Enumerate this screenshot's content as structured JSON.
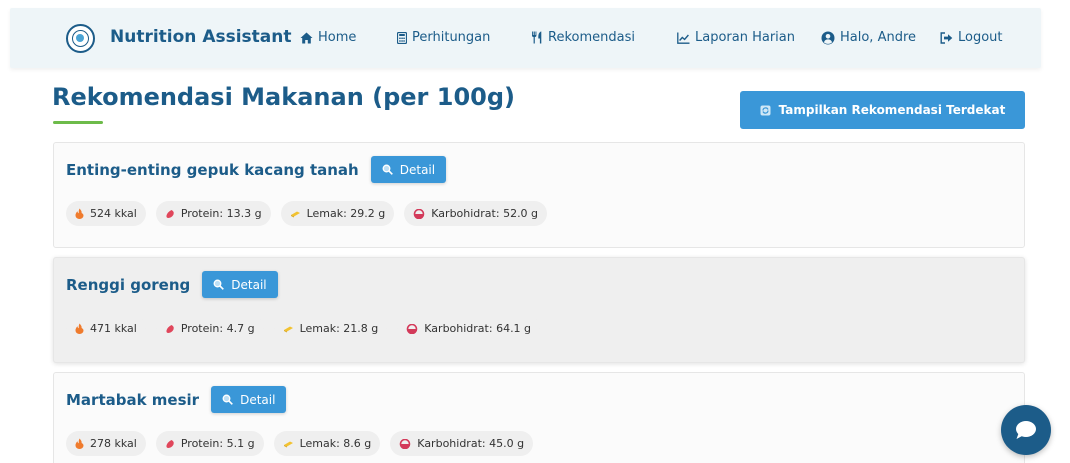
{
  "navbar": {
    "brand": "Nutrition Assistant",
    "items": [
      {
        "label": "Home",
        "icon": "home-icon"
      },
      {
        "label": "Perhitungan",
        "icon": "calculator-icon"
      },
      {
        "label": "Rekomendasi",
        "icon": "utensils-icon"
      },
      {
        "label": "Laporan Harian",
        "icon": "chart-line-icon"
      },
      {
        "label": "Halo, Andre",
        "icon": "user-circle-icon"
      },
      {
        "label": "Logout",
        "icon": "logout-icon"
      }
    ]
  },
  "main": {
    "title": "Rekomendasi Makanan (per 100g)",
    "nearest_button": "Tampilkan Rekomendasi Terdekat",
    "detail_label": "Detail",
    "foods": [
      {
        "name": "Enting-enting gepuk kacang tanah",
        "kcal": "524 kkal",
        "protein": "Protein: 13.3 g",
        "fat": "Lemak: 29.2 g",
        "carbs": "Karbohidrat: 52.0 g"
      },
      {
        "name": "Renggi goreng",
        "kcal": "471 kkal",
        "protein": "Protein: 4.7 g",
        "fat": "Lemak: 21.8 g",
        "carbs": "Karbohidrat: 64.1 g"
      },
      {
        "name": "Martabak mesir",
        "kcal": "278 kkal",
        "protein": "Protein: 5.1 g",
        "fat": "Lemak: 8.6 g",
        "carbs": "Karbohidrat: 45.0 g"
      }
    ]
  },
  "colors": {
    "primary_text": "#1c5c89",
    "button_blue": "#3a97d8",
    "accent_green": "#6dbb4a",
    "navbar_bg": "#eef5f8"
  }
}
